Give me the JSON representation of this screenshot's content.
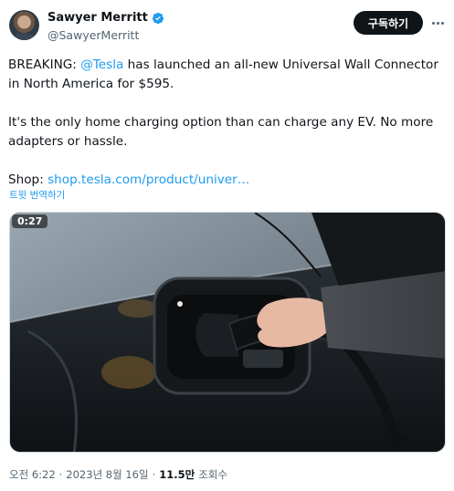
{
  "author": {
    "name": "Sawyer Merritt",
    "handle": "@SawyerMerritt",
    "subscribe_label": "구독하기"
  },
  "tweet": {
    "line1_prefix": "BREAKING: ",
    "mention": "@Tesla",
    "line1_rest": " has launched an all-new Universal Wall Connector in North America for $595.",
    "line2": "It's the only home charging option than can charge any EV. No more adapters or hassle.",
    "shop_prefix": "Shop: ",
    "shop_link": "shop.tesla.com/product/univer…",
    "translate_label": "트윗 번역하기"
  },
  "media": {
    "duration": "0:27"
  },
  "meta": {
    "time": "오전 6:22",
    "date": "2023년 8월 16일",
    "views_count": "11.5만",
    "views_label": "조회수"
  },
  "colors": {
    "link": "#1d9bf0",
    "text": "#0f1419",
    "secondary": "#536471",
    "subscribe_bg": "#0f1419"
  }
}
